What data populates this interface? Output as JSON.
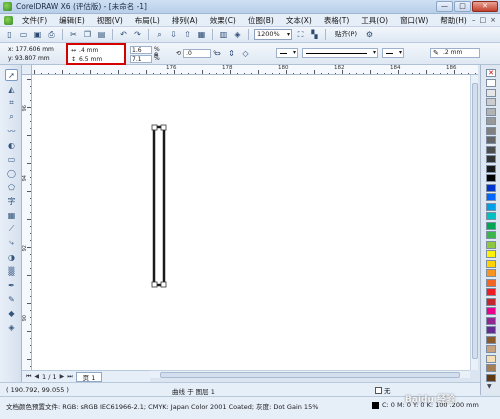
{
  "window": {
    "title": "CorelDRAW X6 (评估版) - [未命名 -1]",
    "minimize": "—",
    "maximize": "□",
    "close": "✕"
  },
  "menu": {
    "items": [
      "文件(F)",
      "编辑(E)",
      "视图(V)",
      "布局(L)",
      "排列(A)",
      "效果(C)",
      "位图(B)",
      "文本(X)",
      "表格(T)",
      "工具(O)",
      "窗口(W)",
      "帮助(H)"
    ],
    "right": [
      "–",
      "□",
      "×"
    ]
  },
  "standard_toolbar": {
    "zoom": "1200%",
    "snap_label": "贴齐(P)",
    "icons": [
      "new-icon",
      "open-icon",
      "save-icon",
      "print-icon",
      "cut-icon",
      "copy-icon",
      "paste-icon",
      "undo-icon",
      "redo-icon",
      "search-icon",
      "import-icon",
      "export-icon",
      "publish-icon",
      "app-launcher-icon",
      "welcome-icon"
    ]
  },
  "property_bar": {
    "x": "x: 177.606 mm",
    "y": "y: 93.807 mm",
    "width": ".4 mm",
    "height": "6.5 mm",
    "scale_w": "1.6",
    "scale_h": "7.1",
    "scale_unit": "%",
    "rotation": ".0",
    "rotation_unit": "°",
    "outline_width": ".2 mm"
  },
  "ruler": {
    "h_labels": [
      "176",
      "178",
      "180",
      "182",
      "184",
      "186",
      "188"
    ],
    "v_labels": [
      "96",
      "94",
      "92",
      "90"
    ]
  },
  "drawing": {
    "stroke_color": "#1a1a1a",
    "handle_color": "#ffffff"
  },
  "palette": {
    "colors": [
      "#ffffff",
      "#e6e6e6",
      "#cccccc",
      "#b3b3b3",
      "#999999",
      "#808080",
      "#666666",
      "#4d4d4d",
      "#333333",
      "#1a1a1a",
      "#000000",
      "#0033cc",
      "#0066ff",
      "#00a0e9",
      "#00c0c0",
      "#00a651",
      "#39b54a",
      "#8dc63f",
      "#fff200",
      "#ffd200",
      "#f7941d",
      "#f26522",
      "#ed1c24",
      "#c1272d",
      "#ec008c",
      "#92278f",
      "#662d91",
      "#8b5a2b",
      "#c7a27c",
      "#f5deb3",
      "#a67c52",
      "#603913"
    ]
  },
  "page_nav": {
    "counter": "1 / 1",
    "page_tab": "页 1"
  },
  "status": {
    "coords": "( 190.792, 99.055 )",
    "layer": "曲线 于 图层 1",
    "fill": "无",
    "color_profile": "文档颜色预置文件: RGB: sRGB IEC61966-2.1; CMYK: Japan Color 2001 Coated; 灰度: Dot Gain 15%",
    "outline": "C: 0 M: 0 Y: 0 K: 100  .200 mm"
  },
  "watermark": "Baidu 经验"
}
